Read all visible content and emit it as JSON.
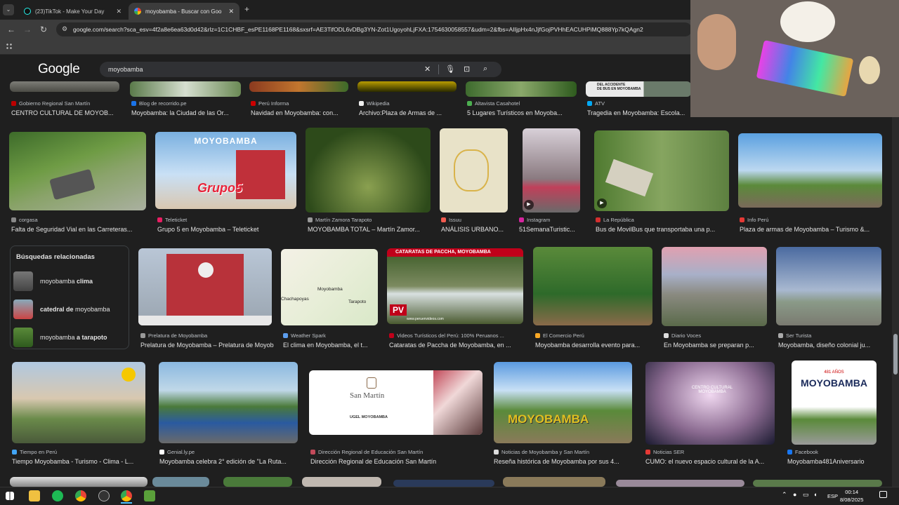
{
  "browser": {
    "tabs": [
      {
        "title": "(23)TikTok - Make Your Day",
        "active": false
      },
      {
        "title": "moyobamba - Buscar con Goo",
        "active": true
      }
    ],
    "new_tab": "+",
    "url": "google.com/search?sca_esv=4f2a8e6ea63d0d42&rlz=1C1CHBF_esPE1168PE1168&sxsrf=AE3TifODL6vDBg3YN-Zot1UgoyohLjFXA:1754630058557&udm=2&fbs=AIIjpHx4nJjfGojPVHhEACUHPiMQ888Yp7kQAgn2"
  },
  "google": {
    "logo": "Google",
    "query": "moyobamba"
  },
  "colors": {
    "page_bg": "#1f1f1f",
    "chrome_bg": "#3c3c3c",
    "text": "#e3e3e3",
    "muted": "#bdc1c6"
  },
  "row0": [
    {
      "source": "Gobierno Regional San Martín",
      "caption": "CENTRO CULTURAL DE MOYOB...",
      "icon": "#b00"
    },
    {
      "source": "Blog de recorrido.pe",
      "caption": "Moyobamba: la Ciudad de las Or...",
      "icon": "#1a73e8"
    },
    {
      "source": "Perú Informa",
      "caption": "Navidad en Moyobamba: con...",
      "icon": "#c00"
    },
    {
      "source": "Wikipedia",
      "caption": "Archivo:Plaza de Armas de ...",
      "icon": "#eee"
    },
    {
      "source": "Altavista Casahotel",
      "caption": "5 Lugares Turísticos en Moyoba...",
      "icon": "#4caf50"
    },
    {
      "source": "ATV",
      "caption": "Tragedia en Moyobamba: Escola...",
      "icon": "#03a9f4"
    }
  ],
  "row1": [
    {
      "source": "corgasa",
      "caption": "Falta de Seguridad Vial en las Carreteras..."
    },
    {
      "source": "Teleticket",
      "caption": "Grupo 5 en Moyobamba – Teleticket",
      "overlay_title": "MOYOBAMBA",
      "overlay_brand": "Grupo5"
    },
    {
      "source": "Martín Zamora Tarapoto",
      "caption": "MOYOBAMBA TOTAL – Martín Zamor..."
    },
    {
      "source": "Issuu",
      "caption": "ANÁLISIS URBANO..."
    },
    {
      "source": "Instagram",
      "caption": "51SemanaTuristic..."
    },
    {
      "source": "La República",
      "caption": "Bus de MovilBus que transportaba una p..."
    },
    {
      "source": "Info Perú",
      "caption": "Plaza de armas de Moyobamba – Turismo &..."
    }
  ],
  "related": {
    "title": "Búsquedas relacionadas",
    "items": [
      {
        "prefix": "moyobamba",
        "bold": "clima",
        "suffix": ""
      },
      {
        "prefix": "",
        "bold": "catedral de",
        "suffix": " moyobamba"
      },
      {
        "prefix": "moyobamba",
        "bold": "a tarapoto",
        "suffix": ""
      }
    ]
  },
  "row2": [
    {
      "source": "Prelatura de Moyobamba",
      "caption": "Prelatura de Moyobamba – Prelatura de Moyobamba"
    },
    {
      "source": "Weather Spark",
      "caption": "El clima en Moyobamba, el t...",
      "map_labels": [
        "Moyobamba",
        "Chachapoyas",
        "Tarapoto"
      ]
    },
    {
      "source": "Videos Turísticos del Perú: 100% Peruanos ...",
      "caption": "Cataratas de Paccha de Moyobamba, en ...",
      "banner": "CATARATAS DE PACCHA, MOYOBAMBA",
      "badge": "PV",
      "site": "www.peruenvideos.com"
    },
    {
      "source": "El Comercio Perú",
      "caption": "Moyobamba desarrolla evento para..."
    },
    {
      "source": "Diario Voces",
      "caption": "En Moyobamba se preparan p..."
    },
    {
      "source": "Ser Turista",
      "caption": "Moyobamba, diseño colonial ju..."
    }
  ],
  "row3": [
    {
      "source": "Tiempo en Perú",
      "caption": "Tiempo Moyobamba - Turismo - Clima - L..."
    },
    {
      "source": "Genial.ly.pe",
      "caption": "Moyobamba celebra 2° edición de \"La Ruta..."
    },
    {
      "source": "Dirección Regional de Educación San Martín",
      "caption": "Dirección Regional de Educación San Martín",
      "logo_title": "San Martín",
      "logo_sub": "UGEL MOYOBAMBA"
    },
    {
      "source": "Noticias de Moyobamba y San Martín",
      "caption": "Reseña histórica de Moyobamba por sus 4...",
      "overlay": "MOYOBAMBA"
    },
    {
      "source": "Noticias SER",
      "caption": "CUMO: el nuevo espacio cultural de la A...",
      "overlay": "CENTRO CULTURAL MOYOBAMBA"
    },
    {
      "source": "Facebook",
      "caption": "Moyobamba481Aniversario",
      "overlay": "MOYOBAMBA",
      "overlay_top": "481 AÑOS"
    }
  ],
  "taskbar": {
    "lang": "ESP",
    "time": "00:14",
    "date": "8/08/2025"
  }
}
